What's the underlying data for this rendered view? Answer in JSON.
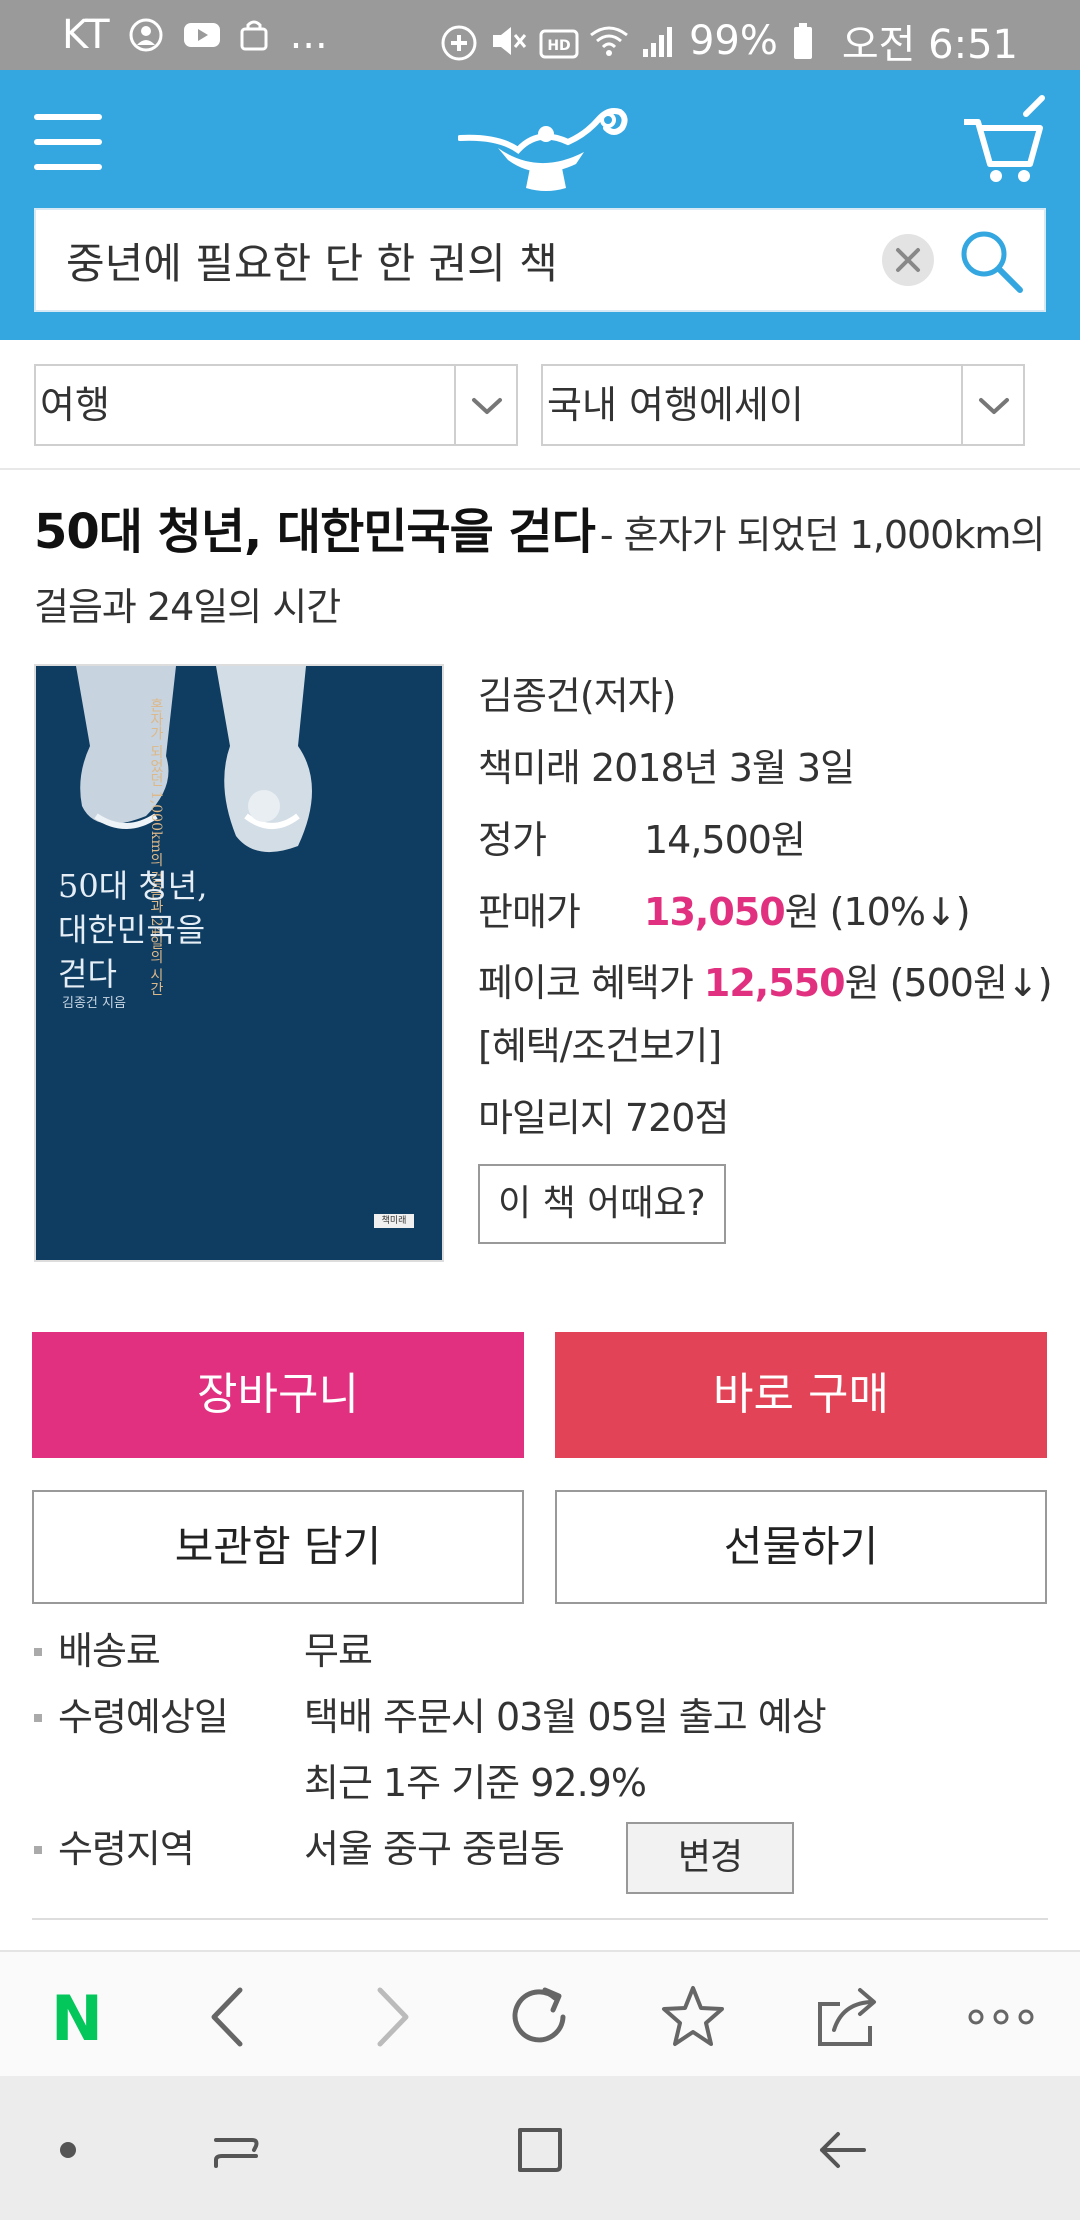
{
  "status_bar": {
    "carrier": "KT",
    "more": "...",
    "battery": "99%",
    "time": "오전 6:51"
  },
  "header": {
    "search_value": "중년에 필요한 단 한 권의 책"
  },
  "categories": {
    "primary": "여행",
    "secondary": "국내 여행에세이"
  },
  "book": {
    "title": "50대 청년, 대한민국을 걷다",
    "subtitle": "- 혼자가 되었던 1,000km의 걸음과 24일의 시간",
    "cover": {
      "title_line1": "50대 청년,",
      "title_line2": "대한민국을",
      "title_line3": "걷다",
      "vertical_text": "혼자가 되었던 1,000km의 걸음과 24일의 시간",
      "author": "김종건 지음",
      "publisher": "책미래"
    },
    "author": "김종건(저자)",
    "publisher_date": "책미래  2018년 3월 3일",
    "list_price_label": "정가",
    "list_price": "14,500원",
    "sale_price_label": "판매가",
    "sale_price": "13,050",
    "sale_price_suffix": "원 (10%↓)",
    "payco_label": "페이코 혜택가 ",
    "payco_price": "12,550",
    "payco_suffix": "원 (500원↓)",
    "benefit_link": "[혜택/조건보기]",
    "mileage": "마일리지  720점",
    "review_button": "이 책 어때요?"
  },
  "actions": {
    "cart": "장바구니",
    "buy_now": "바로 구매",
    "keep": "보관함 담기",
    "gift": "선물하기"
  },
  "delivery": {
    "fee_label": "배송료",
    "fee_value": "무료",
    "eta_label": "수령예상일",
    "eta_value": "택배 주문시 03월 05일 출고 예상",
    "eta_note": "최근 1주 기준 92.9%",
    "region_label": "수령지역",
    "region_value": "서울 중구 중림동",
    "change_button": "변경"
  },
  "browser_bar": {
    "n_logo": "N"
  },
  "colors": {
    "header_blue": "#34a7e1",
    "pink": "#e0307f",
    "buy_red": "#e24356",
    "naver_green": "#03c75a"
  }
}
